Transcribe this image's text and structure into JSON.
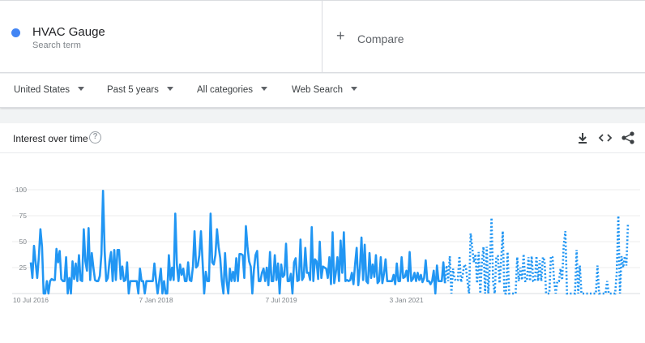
{
  "search": {
    "term": "HVAC Gauge",
    "term_sub": "Search term",
    "term_color": "#4285f4",
    "compare_label": "Compare"
  },
  "filters": {
    "region": "United States",
    "time": "Past 5 years",
    "category": "All categories",
    "property": "Web Search"
  },
  "card": {
    "title": "Interest over time",
    "help_glyph": "?"
  },
  "chart_data": {
    "type": "line",
    "title": "",
    "xlabel": "",
    "ylabel": "",
    "ylim": [
      0,
      100
    ],
    "yticks": [
      {
        "value": 25,
        "label": "25"
      },
      {
        "value": 50,
        "label": "50"
      },
      {
        "value": 75,
        "label": "75"
      },
      {
        "value": 100,
        "label": "100"
      }
    ],
    "xticks": [
      {
        "index": 0,
        "label": "10 Jul 2016"
      },
      {
        "index": 78,
        "label": "7 Jan 2018"
      },
      {
        "index": 156,
        "label": "7 Jul 2019"
      },
      {
        "index": 234,
        "label": "3 Jan 2021"
      }
    ],
    "grid": true,
    "legend": "none",
    "series": [
      {
        "color": "#2196f3",
        "partial_from_index": 258,
        "values": [
          30,
          15,
          46,
          30,
          15,
          35,
          62,
          45,
          0,
          0,
          12,
          0,
          12,
          14,
          13,
          13,
          43,
          30,
          41,
          14,
          12,
          12,
          35,
          0,
          15,
          0,
          31,
          14,
          29,
          12,
          37,
          13,
          12,
          62,
          31,
          22,
          63,
          13,
          39,
          25,
          13,
          12,
          12,
          17,
          38,
          99,
          41,
          12,
          15,
          31,
          40,
          12,
          42,
          13,
          42,
          42,
          14,
          26,
          12,
          13,
          30,
          0,
          12,
          12,
          12,
          12,
          12,
          0,
          24,
          12,
          12,
          0,
          12,
          12,
          12,
          12,
          12,
          29,
          13,
          0,
          12,
          24,
          0,
          12,
          0,
          0,
          37,
          13,
          25,
          13,
          77,
          28,
          12,
          28,
          18,
          24,
          12,
          12,
          30,
          13,
          12,
          26,
          60,
          25,
          27,
          37,
          60,
          31,
          0,
          21,
          12,
          12,
          77,
          30,
          28,
          37,
          62,
          45,
          34,
          12,
          0,
          39,
          12,
          0,
          24,
          12,
          21,
          12,
          34,
          12,
          38,
          38,
          37,
          15,
          65,
          45,
          31,
          26,
          0,
          23,
          37,
          41,
          12,
          12,
          20,
          24,
          12,
          25,
          8,
          40,
          12,
          12,
          37,
          13,
          29,
          0,
          28,
          16,
          18,
          48,
          12,
          12,
          19,
          0,
          30,
          34,
          12,
          13,
          52,
          13,
          16,
          44,
          20,
          20,
          13,
          64,
          12,
          33,
          31,
          14,
          50,
          15,
          26,
          25,
          24,
          15,
          35,
          9,
          59,
          10,
          20,
          35,
          12,
          51,
          20,
          59,
          12,
          13,
          12,
          13,
          20,
          9,
          28,
          44,
          8,
          24,
          54,
          13,
          47,
          12,
          10,
          39,
          15,
          28,
          16,
          37,
          10,
          12,
          35,
          10,
          19,
          33,
          12,
          12,
          12,
          12,
          18,
          9,
          29,
          12,
          12,
          35,
          15,
          16,
          22,
          12,
          40,
          12,
          14,
          20,
          12,
          20,
          13,
          18,
          11,
          15,
          32,
          12,
          12,
          9,
          12,
          22,
          0,
          27,
          12,
          12,
          12,
          30,
          10,
          27,
          12,
          36,
          0,
          24,
          14,
          12,
          13,
          36,
          11,
          17,
          28,
          26,
          12,
          0,
          58,
          44,
          30,
          38,
          10,
          40,
          0,
          30,
          45,
          0,
          45,
          0,
          29,
          73,
          11,
          0,
          36,
          36,
          10,
          32,
          60,
          0,
          0,
          40,
          0,
          0,
          0,
          0,
          0,
          35,
          12,
          25,
          13,
          38,
          12,
          12,
          35,
          12,
          36,
          12,
          12,
          36,
          12,
          32,
          12,
          35,
          32,
          0,
          0,
          0,
          36,
          35,
          12,
          0,
          12,
          12,
          24,
          13,
          47,
          60,
          0,
          0,
          0,
          0,
          0,
          0,
          42,
          0,
          27,
          0,
          0,
          0,
          0,
          0,
          0,
          0,
          0,
          0,
          0,
          27,
          0,
          0,
          0,
          0,
          0,
          12,
          0,
          0,
          0,
          0,
          0,
          20,
          75,
          0,
          36,
          25,
          36,
          27,
          68
        ]
      }
    ]
  }
}
